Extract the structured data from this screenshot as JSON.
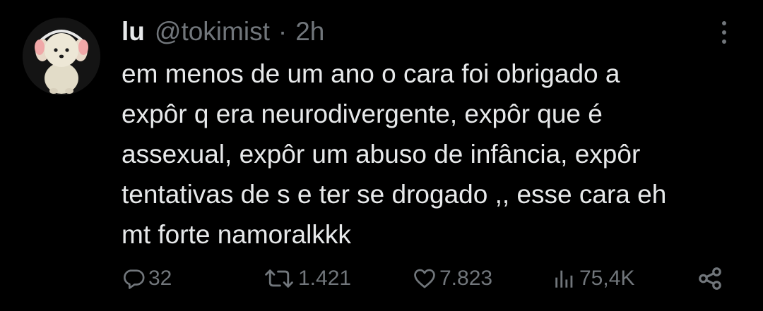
{
  "tweet": {
    "author": {
      "name": "lu",
      "handle": "@tokimist",
      "separator": "·",
      "time": "2h"
    },
    "text_lines": [
      "em menos de um ano o cara foi obrigado a",
      "expôr q era neurodivergente, expôr que é",
      "assexual, expôr um abuso de infância, expôr",
      "tentativas de s e ter se drogado ,, esse cara eh",
      "mt forte namoralkkk"
    ],
    "actions": {
      "replies": "32",
      "retweets": "1.421",
      "likes": "7.823",
      "views": "75,4K"
    }
  },
  "icons": {
    "avatar": "white-puppy-with-headphones-avatar",
    "more": "vertical-ellipsis-icon",
    "reply": "reply-bubble-icon",
    "retweet": "retweet-icon",
    "like": "heart-icon",
    "views": "bar-chart-icon",
    "share": "share-icon"
  },
  "colors": {
    "background": "#000000",
    "primary_text": "#e7e9ea",
    "secondary_text": "#71767b"
  }
}
